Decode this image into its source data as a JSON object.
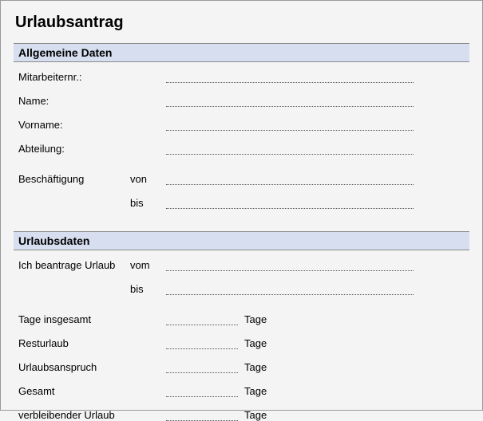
{
  "title": "Urlaubsantrag",
  "section1": {
    "header": "Allgemeine Daten",
    "mitarbeiternr": "Mitarbeiternr.:",
    "name": "Name:",
    "vorname": "Vorname:",
    "abteilung": "Abteilung:",
    "beschaeftigung": "Beschäftigung",
    "von": "von",
    "bis": "bis"
  },
  "section2": {
    "header": "Urlaubsdaten",
    "beantrage": "Ich beantrage Urlaub",
    "vom": "vom",
    "bis": "bis",
    "tage_insgesamt": "Tage insgesamt",
    "resturlaub": "Resturlaub",
    "urlaubsanspruch": "Urlaubsanspruch",
    "gesamt": "Gesamt",
    "verbleibender": "verbleibender Urlaub",
    "unit": "Tage"
  }
}
